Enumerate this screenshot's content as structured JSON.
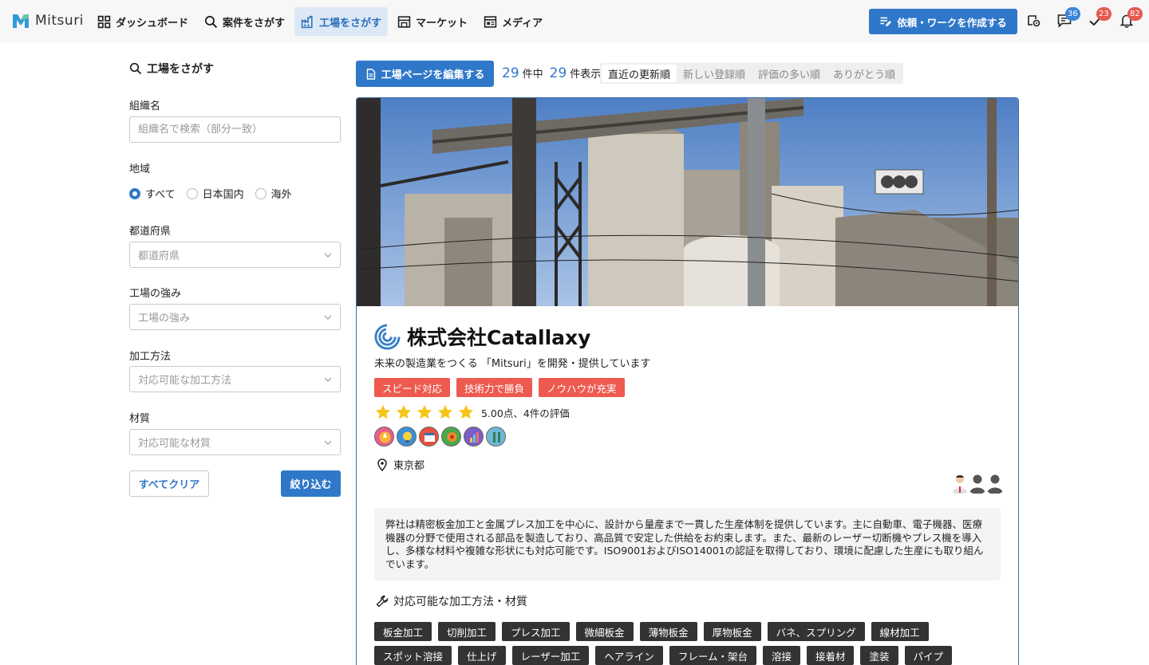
{
  "app": {
    "logo_text": "Mitsuri"
  },
  "nav": {
    "items": [
      {
        "label": "ダッシュボード",
        "icon": "grid-icon"
      },
      {
        "label": "案件をさがす",
        "icon": "search-icon"
      },
      {
        "label": "工場をさがす",
        "icon": "factory-icon"
      },
      {
        "label": "マーケット",
        "icon": "store-icon"
      },
      {
        "label": "メディア",
        "icon": "newspaper-icon"
      }
    ],
    "active_index": 2,
    "create_label": "依頼・ワークを作成する",
    "messages_badge": "36",
    "tasks_badge": "23",
    "notifications_badge": "82"
  },
  "sidebar": {
    "title": "工場をさがす",
    "org_label": "組織名",
    "org_placeholder": "組織名で検索（部分一致）",
    "region_label": "地域",
    "region_options": [
      "すべて",
      "日本国内",
      "海外"
    ],
    "region_selected": "すべて",
    "pref_label": "都道府県",
    "pref_placeholder": "都道府県",
    "strength_label": "工場の強み",
    "strength_placeholder": "工場の強み",
    "method_label": "加工方法",
    "method_placeholder": "対応可能な加工方法",
    "material_label": "材質",
    "material_placeholder": "対応可能な材質",
    "clear_label": "すべてクリア",
    "filter_label": "絞り込む"
  },
  "toolbar": {
    "edit_label": "工場ページを編集する",
    "total": "29",
    "total_suffix": "件中",
    "shown": "29",
    "shown_suffix": "件表示",
    "sorts": [
      "直近の更新順",
      "新しい登録順",
      "評価の多い順",
      "ありがとう順"
    ],
    "sort_active": 0
  },
  "card": {
    "company_name": "株式会社Catallaxy",
    "tagline": "未来の製造業をつくる 「Mitsuri」を開発・提供しています",
    "tags": [
      "スピード対応",
      "技術力で勝負",
      "ノウハウが充実"
    ],
    "rating": 5,
    "rating_text": "5.00点、4件の評価",
    "location": "東京都",
    "description": "弊社は精密板金加工と金属プレス加工を中心に、設計から量産まで一貫した生産体制を提供しています。主に自動車、電子機器、医療機器の分野で使用される部品を製造しており、高品質で安定した供給をお約束します。また、最新のレーザー切断機やプレス機を導入し、多様な材料や複雑な形状にも対応可能です。ISO9001およびISO14001の認証を取得しており、環境に配慮した生産にも取り組んでいます。",
    "capabilities_title": "対応可能な加工方法・材質",
    "capabilities": [
      "板金加工",
      "切削加工",
      "プレス加工",
      "微細板金",
      "薄物板金",
      "厚物板金",
      "バネ、スプリング",
      "線材加工",
      "スポット溶接",
      "仕上げ",
      "レーザー加工",
      "ヘアライン",
      "フレーム・架台",
      "溶接",
      "接着材",
      "塗装",
      "パイプ"
    ]
  },
  "colors": {
    "primary": "#2f78c9",
    "tag": "#ee5a4f",
    "chip": "#333333",
    "star": "#f5c518"
  }
}
